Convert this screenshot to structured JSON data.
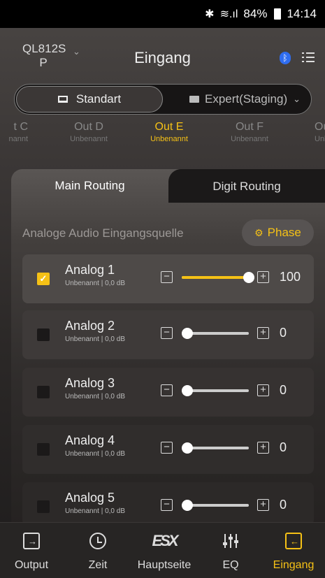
{
  "status": {
    "battery": "84%",
    "time": "14:14"
  },
  "header": {
    "device": "QL812S P",
    "device_line1": "QL812S",
    "device_line2": "P",
    "title": "Eingang"
  },
  "mode": {
    "standard": "Standart",
    "expert": "Expert(Staging)"
  },
  "outputs": [
    {
      "name": "t C",
      "sub": "nannt"
    },
    {
      "name": "Out D",
      "sub": "Unbenannt"
    },
    {
      "name": "Out E",
      "sub": "Unbenannt",
      "active": true
    },
    {
      "name": "Out F",
      "sub": "Unbenannt"
    },
    {
      "name": "Ou",
      "sub": "Unbe"
    }
  ],
  "tabs": {
    "main": "Main Routing",
    "digit": "Digit Routing"
  },
  "section": {
    "label": "Analoge Audio Eingangsquelle",
    "phase": "Phase"
  },
  "inputs": [
    {
      "name": "Analog 1",
      "sub": "Unbenannt  |  0,0 dB",
      "checked": true,
      "value": "100",
      "level": 1.0
    },
    {
      "name": "Analog 2",
      "sub": "Unbenannt  |  0,0 dB",
      "checked": false,
      "value": "0",
      "level": 0
    },
    {
      "name": "Analog 3",
      "sub": "Unbenannt  |  0,0 dB",
      "checked": false,
      "value": "0",
      "level": 0
    },
    {
      "name": "Analog 4",
      "sub": "Unbenannt  |  0,0 dB",
      "checked": false,
      "value": "0",
      "level": 0
    },
    {
      "name": "Analog 5",
      "sub": "Unbenannt  |  0,0 dB",
      "checked": false,
      "value": "0",
      "level": 0
    }
  ],
  "nav": [
    {
      "label": "Output",
      "icon": "output-icon"
    },
    {
      "label": "Zeit",
      "icon": "clock-icon"
    },
    {
      "label": "Hauptseite",
      "icon": "esx-logo-icon"
    },
    {
      "label": "EQ",
      "icon": "equalizer-icon"
    },
    {
      "label": "Eingang",
      "icon": "input-icon",
      "active": true
    }
  ],
  "colors": {
    "accent": "#f5c116",
    "bluetooth": "#2f6df0"
  }
}
